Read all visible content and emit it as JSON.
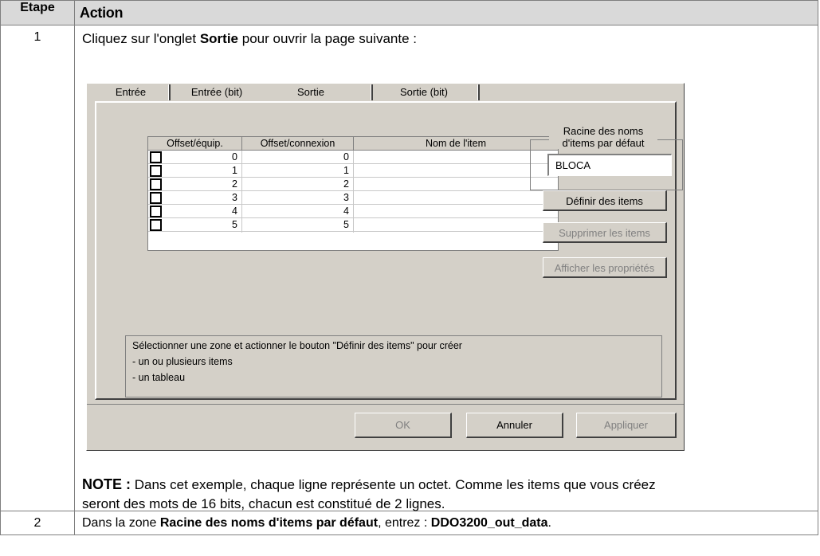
{
  "table": {
    "headers": [
      "Etape",
      "Action"
    ],
    "rows": [
      {
        "step": "1",
        "text_before": "Cliquez sur l'onglet ",
        "text_bold": "Sortie",
        "text_after": " pour ouvrir la page suivante :",
        "note_label": "NOTE :",
        "note_line1": " Dans cet exemple, chaque ligne représente un octet. Comme les items que vous créez",
        "note_line2": "seront des mots de 16 bits, chacun est constitué de 2 lignes."
      },
      {
        "step": "2",
        "text_before": "Dans la zone ",
        "text_bold": "Racine des noms d'items par défaut",
        "text_middle": ", entrez : ",
        "text_bold2": "DDO3200_out_data",
        "text_after": "."
      }
    ]
  },
  "dialog": {
    "tabs": [
      "Entrée",
      "Entrée (bit)",
      "Sortie",
      "Sortie (bit)"
    ],
    "active_tab": "Sortie",
    "grid": {
      "columns": [
        "Offset/équip.",
        "Offset/connexion",
        "Nom de l'item"
      ],
      "rows": [
        {
          "equip": "0",
          "connexion": "0",
          "name": ""
        },
        {
          "equip": "1",
          "connexion": "1",
          "name": ""
        },
        {
          "equip": "2",
          "connexion": "2",
          "name": ""
        },
        {
          "equip": "3",
          "connexion": "3",
          "name": ""
        },
        {
          "equip": "4",
          "connexion": "4",
          "name": ""
        },
        {
          "equip": "5",
          "connexion": "5",
          "name": ""
        }
      ]
    },
    "group_title_line1": "Racine des noms",
    "group_title_line2": "d'items par défaut",
    "root_name_value": "BLOCA",
    "buttons": {
      "define": "Définir des items",
      "delete": "Supprimer les items",
      "properties": "Afficher les propriétés",
      "ok": "OK",
      "cancel": "Annuler",
      "apply": "Appliquer"
    },
    "message": {
      "line1": "Sélectionner une zone et actionner le bouton \"Définir des items\" pour créer",
      "line2": "- un ou plusieurs items",
      "line3": "- un tableau"
    }
  }
}
